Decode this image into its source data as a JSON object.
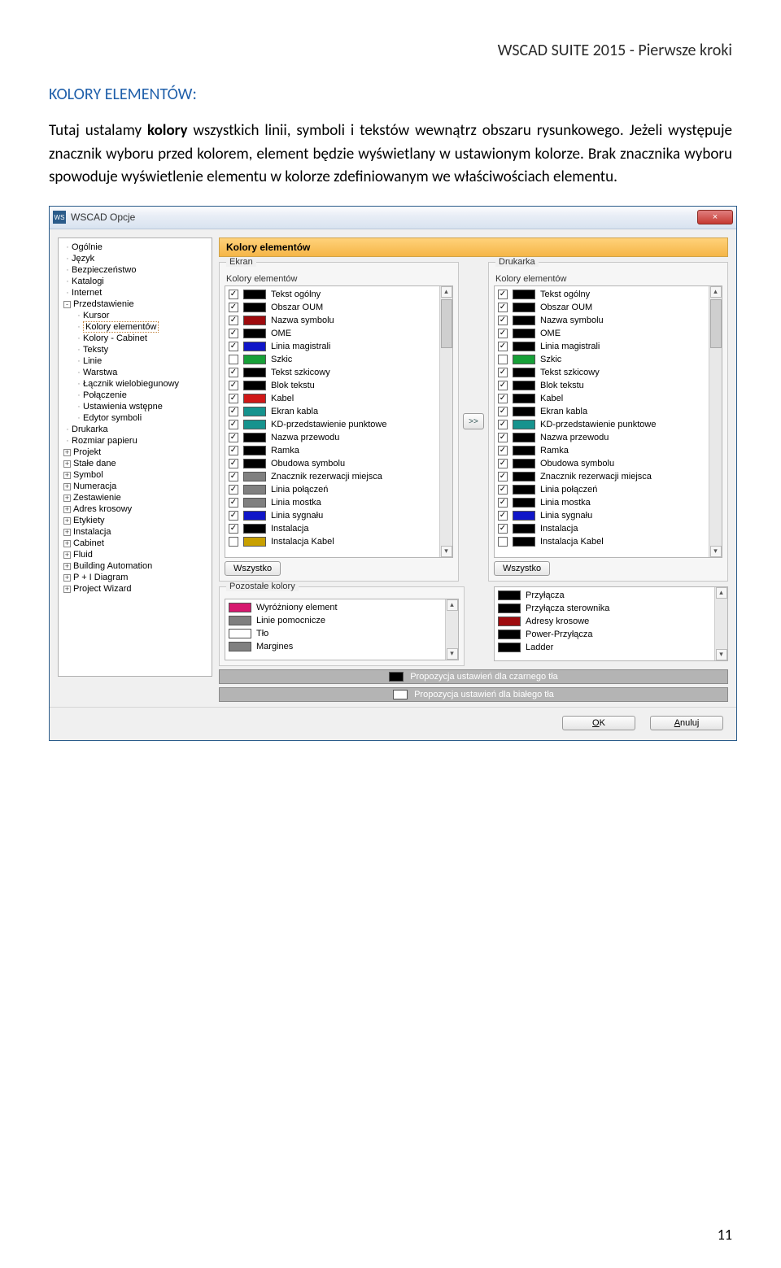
{
  "doc": {
    "header": "WSCAD SUITE 2015 - Pierwsze kroki",
    "section_heading": "KOLORY ELEMENTÓW:",
    "para1_a": "Tutaj ustalamy ",
    "para1_b": "kolory",
    "para1_c": " wszystkich linii, symboli i tekstów wewnątrz obszaru rysunkowego. Jeżeli występuje znacznik wyboru przed kolorem, element będzie wyświetlany w ustawionym kolorze. Brak znacznika wyboru spowoduje wyświetlenie elementu w kolorze zdefiniowanym we właściwościach elementu.",
    "page_number": "11"
  },
  "dialog": {
    "title": "WSCAD Opcje",
    "close_icon": "×",
    "pane_title": "Kolory elementów",
    "tree": [
      {
        "label": "Ogólnie",
        "ex": null,
        "indent": 0
      },
      {
        "label": "Język",
        "ex": null,
        "indent": 0
      },
      {
        "label": "Bezpieczeństwo",
        "ex": null,
        "indent": 0
      },
      {
        "label": "Katalogi",
        "ex": null,
        "indent": 0
      },
      {
        "label": "Internet",
        "ex": null,
        "indent": 0
      },
      {
        "label": "Przedstawienie",
        "ex": "-",
        "indent": 0
      },
      {
        "label": "Kursor",
        "ex": null,
        "indent": 1
      },
      {
        "label": "Kolory elementów",
        "ex": null,
        "indent": 1,
        "selected": true
      },
      {
        "label": "Kolory - Cabinet",
        "ex": null,
        "indent": 1
      },
      {
        "label": "Teksty",
        "ex": null,
        "indent": 1
      },
      {
        "label": "Linie",
        "ex": null,
        "indent": 1
      },
      {
        "label": "Warstwa",
        "ex": null,
        "indent": 1
      },
      {
        "label": "Łącznik wielobiegunowy",
        "ex": null,
        "indent": 1
      },
      {
        "label": "Połączenie",
        "ex": null,
        "indent": 1
      },
      {
        "label": "Ustawienia wstępne",
        "ex": null,
        "indent": 1
      },
      {
        "label": "Edytor symboli",
        "ex": null,
        "indent": 1
      },
      {
        "label": "Drukarka",
        "ex": null,
        "indent": 0
      },
      {
        "label": "Rozmiar papieru",
        "ex": null,
        "indent": 0
      },
      {
        "label": "Projekt",
        "ex": "+",
        "indent": 0
      },
      {
        "label": "Stałe dane",
        "ex": "+",
        "indent": 0
      },
      {
        "label": "Symbol",
        "ex": "+",
        "indent": 0
      },
      {
        "label": "Numeracja",
        "ex": "+",
        "indent": 0
      },
      {
        "label": "Zestawienie",
        "ex": "+",
        "indent": 0
      },
      {
        "label": "Adres krosowy",
        "ex": "+",
        "indent": 0
      },
      {
        "label": "Etykiety",
        "ex": "+",
        "indent": 0
      },
      {
        "label": "Instalacja",
        "ex": "+",
        "indent": 0
      },
      {
        "label": "Cabinet",
        "ex": "+",
        "indent": 0
      },
      {
        "label": "Fluid",
        "ex": "+",
        "indent": 0
      },
      {
        "label": "Building Automation",
        "ex": "+",
        "indent": 0
      },
      {
        "label": "P + I Diagram",
        "ex": "+",
        "indent": 0
      },
      {
        "label": "Project Wizard",
        "ex": "+",
        "indent": 0
      }
    ],
    "group_ekran": "Ekran",
    "group_drukarka": "Drukarka",
    "sub_legend": "Kolory elementów",
    "btn_all": "Wszystko",
    "btn_transfer": ">>",
    "group_other": "Pozostałe kolory",
    "ekran_items": [
      {
        "c": true,
        "color": "#000000",
        "label": "Tekst ogólny"
      },
      {
        "c": true,
        "color": "#000000",
        "label": "Obszar OUM"
      },
      {
        "c": true,
        "color": "#9e0b0e",
        "label": "Nazwa symbolu"
      },
      {
        "c": true,
        "color": "#000000",
        "label": "OME"
      },
      {
        "c": true,
        "color": "#1016c8",
        "label": "Linia magistrali"
      },
      {
        "c": false,
        "color": "#17a038",
        "label": "Szkic"
      },
      {
        "c": true,
        "color": "#000000",
        "label": "Tekst szkicowy"
      },
      {
        "c": true,
        "color": "#000000",
        "label": "Blok tekstu"
      },
      {
        "c": true,
        "color": "#d01818",
        "label": "Kabel"
      },
      {
        "c": true,
        "color": "#16938e",
        "label": "Ekran kabla"
      },
      {
        "c": true,
        "color": "#16938e",
        "label": "KD-przedstawienie punktowe"
      },
      {
        "c": true,
        "color": "#000000",
        "label": "Nazwa przewodu"
      },
      {
        "c": true,
        "color": "#000000",
        "label": "Ramka"
      },
      {
        "c": true,
        "color": "#000000",
        "label": "Obudowa symbolu"
      },
      {
        "c": true,
        "color": "#808080",
        "label": "Znacznik rezerwacji miejsca"
      },
      {
        "c": true,
        "color": "#808080",
        "label": "Linia połączeń"
      },
      {
        "c": true,
        "color": "#808080",
        "label": "Linia mostka"
      },
      {
        "c": true,
        "color": "#1016c8",
        "label": "Linia sygnału"
      },
      {
        "c": true,
        "color": "#000000",
        "label": "Instalacja"
      },
      {
        "c": false,
        "color": "#c8a000",
        "label": "Instalacja Kabel"
      }
    ],
    "drukarka_items": [
      {
        "c": true,
        "color": "#000000",
        "label": "Tekst ogólny"
      },
      {
        "c": true,
        "color": "#000000",
        "label": "Obszar OUM"
      },
      {
        "c": true,
        "color": "#000000",
        "label": "Nazwa symbolu"
      },
      {
        "c": true,
        "color": "#000000",
        "label": "OME"
      },
      {
        "c": true,
        "color": "#000000",
        "label": "Linia magistrali"
      },
      {
        "c": false,
        "color": "#17a038",
        "label": "Szkic"
      },
      {
        "c": true,
        "color": "#000000",
        "label": "Tekst szkicowy"
      },
      {
        "c": true,
        "color": "#000000",
        "label": "Blok tekstu"
      },
      {
        "c": true,
        "color": "#000000",
        "label": "Kabel"
      },
      {
        "c": true,
        "color": "#000000",
        "label": "Ekran kabla"
      },
      {
        "c": true,
        "color": "#16938e",
        "label": "KD-przedstawienie punktowe"
      },
      {
        "c": true,
        "color": "#000000",
        "label": "Nazwa przewodu"
      },
      {
        "c": true,
        "color": "#000000",
        "label": "Ramka"
      },
      {
        "c": true,
        "color": "#000000",
        "label": "Obudowa symbolu"
      },
      {
        "c": true,
        "color": "#000000",
        "label": "Znacznik rezerwacji miejsca"
      },
      {
        "c": true,
        "color": "#000000",
        "label": "Linia połączeń"
      },
      {
        "c": true,
        "color": "#000000",
        "label": "Linia mostka"
      },
      {
        "c": true,
        "color": "#1016c8",
        "label": "Linia sygnału"
      },
      {
        "c": true,
        "color": "#000000",
        "label": "Instalacja"
      },
      {
        "c": false,
        "color": "#000000",
        "label": "Instalacja Kabel"
      }
    ],
    "other_left": [
      {
        "color": "#d6186f",
        "label": "Wyróżniony element"
      },
      {
        "color": "#808080",
        "label": "Linie pomocnicze"
      },
      {
        "color": "#ffffff",
        "label": "Tło"
      },
      {
        "color": "#808080",
        "label": "Margines"
      }
    ],
    "other_right": [
      {
        "color": "#000000",
        "label": "Przyłącza"
      },
      {
        "color": "#000000",
        "label": "Przyłącza sterownika"
      },
      {
        "color": "#9e0b0e",
        "label": "Adresy krosowe"
      },
      {
        "color": "#000000",
        "label": "Power-Przyłącza"
      },
      {
        "color": "#000000",
        "label": "Ladder"
      }
    ],
    "proposal_black": "Propozycja ustawień dla czarnego tła",
    "proposal_white": "Propozycja ustawień dla białego tła",
    "ok": "OK",
    "cancel": "Anuluj"
  }
}
